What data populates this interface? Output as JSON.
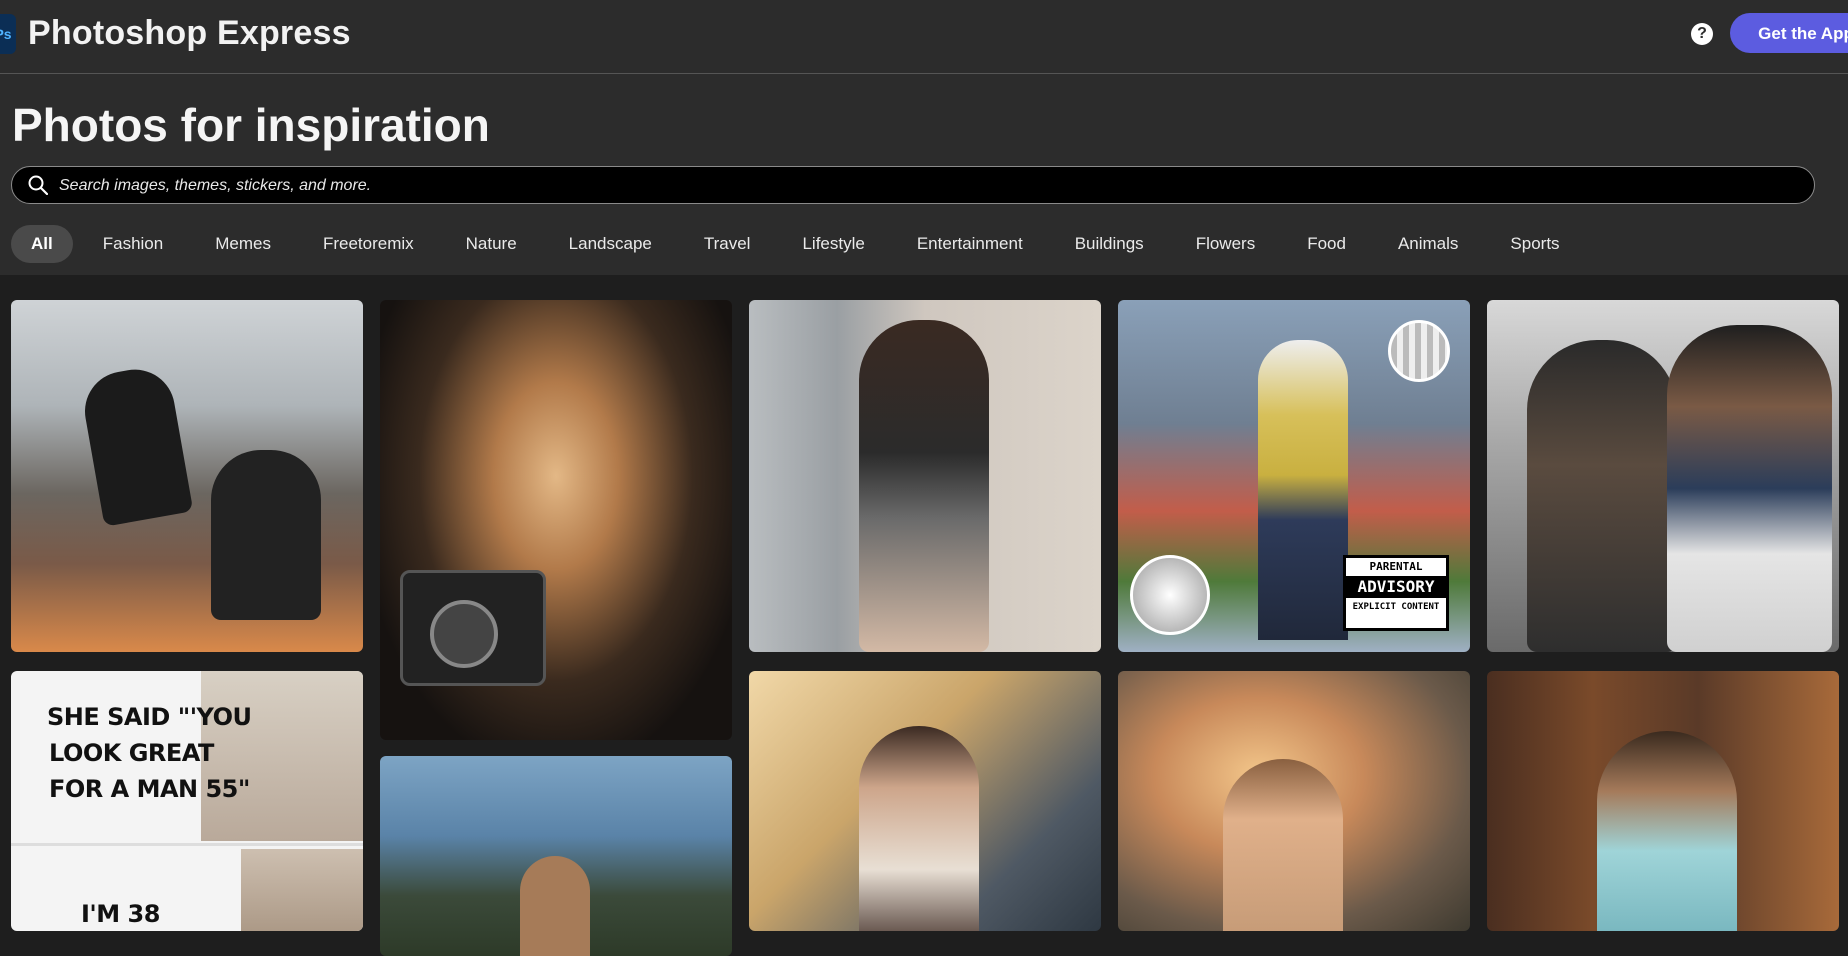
{
  "header": {
    "logo_text": "Ps",
    "title": "Photoshop Express",
    "help_label": "?",
    "cta_label": "Get the App"
  },
  "hero": {
    "title": "Photos for inspiration",
    "search": {
      "placeholder": "Search images, themes, stickers, and more.",
      "value": ""
    },
    "tabs": [
      {
        "label": "All",
        "active": true
      },
      {
        "label": "Fashion"
      },
      {
        "label": "Memes"
      },
      {
        "label": "Freetoremix"
      },
      {
        "label": "Nature"
      },
      {
        "label": "Landscape"
      },
      {
        "label": "Travel"
      },
      {
        "label": "Lifestyle"
      },
      {
        "label": "Entertainment"
      },
      {
        "label": "Buildings"
      },
      {
        "label": "Flowers"
      },
      {
        "label": "Food"
      },
      {
        "label": "Animals"
      },
      {
        "label": "Sports"
      }
    ]
  },
  "gallery": {
    "meme_text": "SHE SAID \"'YOU LOOK GREAT FOR A MAN 55\"",
    "meme_line1": "SHE SAID \"'YOU",
    "meme_line2": "LOOK GREAT",
    "meme_line3": "FOR A MAN 55\"",
    "meme_line4": "I'M 38",
    "sticker_top": "PARENTAL",
    "sticker_mid": "ADVISORY",
    "sticker_bot": "EXPLICIT CONTENT"
  },
  "colors": {
    "header_bg": "#2c2c2c",
    "page_bg": "#1e1e1e",
    "cta_bg": "#5c5ce0",
    "tab_active_bg": "#4a4a4a"
  }
}
